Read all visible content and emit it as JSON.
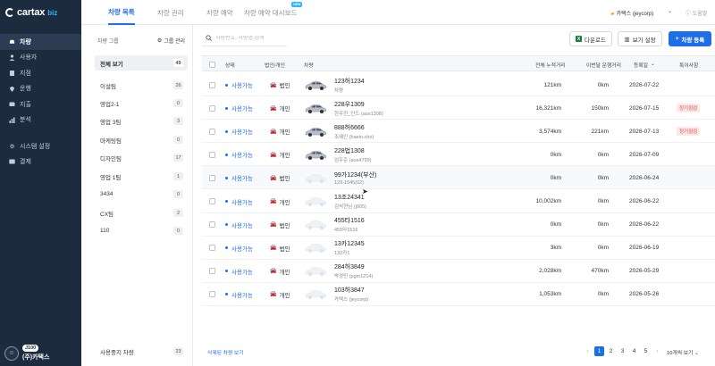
{
  "brand": {
    "name": "cartax",
    "suffix": "biz"
  },
  "sidebar": {
    "items": [
      {
        "label": "차량",
        "icon": "car-icon",
        "active": true
      },
      {
        "label": "사용자",
        "icon": "user-icon",
        "active": false
      },
      {
        "label": "지점",
        "icon": "branch-icon",
        "active": false
      },
      {
        "label": "운행",
        "icon": "location-icon",
        "active": false
      },
      {
        "label": "지출",
        "icon": "wallet-icon",
        "active": false
      },
      {
        "label": "분석",
        "icon": "chart-icon",
        "active": false
      }
    ],
    "bottom_items": [
      {
        "label": "시스템 설정",
        "icon": "gear-icon"
      },
      {
        "label": "결제",
        "icon": "card-icon"
      }
    ],
    "profile": {
      "badge": "J100",
      "name": "(주)카택스"
    }
  },
  "topbar": {
    "tabs": [
      {
        "label": "차량 목록",
        "active": true
      },
      {
        "label": "차량 관리",
        "active": false
      },
      {
        "label": "차량 예약",
        "active": false
      },
      {
        "label": "차량 예약 대시보드",
        "active": false,
        "badge": "NEW"
      }
    ],
    "account": "카택스 (jeycorp)",
    "help": "도움말"
  },
  "groups": {
    "title": "차량 그룹",
    "manage_label": "그룹 관리",
    "items": [
      {
        "label": "전체 보기",
        "count": "49",
        "active": true
      },
      {
        "label": "이설팀",
        "count": "26"
      },
      {
        "label": "영업2-1",
        "count": "0"
      },
      {
        "label": "영업 3팀",
        "count": "3"
      },
      {
        "label": "마케팅팀",
        "count": "0"
      },
      {
        "label": "디자인팀",
        "count": "17"
      },
      {
        "label": "영업 1팀",
        "count": "1"
      },
      {
        "label": "3434",
        "count": "0"
      },
      {
        "label": "CX팀",
        "count": "2"
      },
      {
        "label": "110",
        "count": "0"
      }
    ],
    "suspended": {
      "label": "사용중지 차량",
      "count": "23"
    }
  },
  "toolbar": {
    "search_placeholder": "차량번호, 차량명 검색",
    "download": "다운로드",
    "view_settings": "보기 설정",
    "add_vehicle": "차량 등록"
  },
  "table": {
    "headers": {
      "status": "상태",
      "ownership": "법인/개인",
      "vehicle": "차량",
      "total_distance": "전체 누적거리",
      "last_month": "이번달 운행거리",
      "registered": "등록일",
      "notes": "특이사항"
    },
    "rows": [
      {
        "status": "사용가능",
        "ownership": "법인",
        "plate": "123허1234",
        "owner": "차량",
        "car": "silver",
        "total": "121km",
        "month": "0km",
        "date": "2026-07-22",
        "note": ""
      },
      {
        "status": "사용가능",
        "ownership": "개인",
        "plate": "228우1309",
        "owner": "한우진_인드 (aos1308)",
        "car": "silver",
        "total": "16,321km",
        "month": "150km",
        "date": "2026-07-15",
        "note": "정기점검"
      },
      {
        "status": "사용가능",
        "ownership": "개인",
        "plate": "888허6666",
        "owner": "조혜인 (haein.cho)",
        "car": "silver",
        "total": "3,574km",
        "month": "221km",
        "date": "2026-07-13",
        "note": "정기점검"
      },
      {
        "status": "사용가능",
        "ownership": "개인",
        "plate": "228법1308",
        "owner": "임우준 (aos4799)",
        "car": "silver",
        "total": "0km",
        "month": "0km",
        "date": "2026-07-09",
        "note": ""
      },
      {
        "status": "사용가능",
        "ownership": "법인",
        "plate": "99가1234(부산)",
        "owner": "123-1545(02)",
        "car": "ghost",
        "total": "0km",
        "month": "0km",
        "date": "2026-06-24",
        "note": ""
      },
      {
        "status": "사용가능",
        "ownership": "개인",
        "plate": "13조24341",
        "owner": "김석현님 (j005)",
        "car": "ghost",
        "total": "10,002km",
        "month": "0km",
        "date": "2026-06-22",
        "note": ""
      },
      {
        "status": "사용가능",
        "ownership": "법인",
        "plate": "455타1516",
        "owner": "455타1516",
        "car": "ghost",
        "total": "0km",
        "month": "0km",
        "date": "2026-06-22",
        "note": ""
      },
      {
        "status": "사용가능",
        "ownership": "법인",
        "plate": "13카12345",
        "owner": "132카1",
        "car": "ghost",
        "total": "3km",
        "month": "0km",
        "date": "2026-06-19",
        "note": ""
      },
      {
        "status": "사용가능",
        "ownership": "개인",
        "plate": "284허3849",
        "owner": "박경민 (pgm1214)",
        "car": "ghost",
        "total": "2,028km",
        "month": "470km",
        "date": "2026-05-29",
        "note": ""
      },
      {
        "status": "사용가능",
        "ownership": "개인",
        "plate": "103허3847",
        "owner": "카택스 (jeycorp)",
        "car": "ghost",
        "total": "1,053km",
        "month": "0km",
        "date": "2026-05-26",
        "note": ""
      }
    ]
  },
  "footer": {
    "deleted_link": "삭제된 차량 보기",
    "pages": [
      "1",
      "2",
      "3",
      "4",
      "5"
    ],
    "current_page": "1",
    "per_page": "10개씩 보기"
  },
  "colors": {
    "accent": "#1e6ee8",
    "sidebar": "#1d2b3e",
    "badge_red": "#e04a4a",
    "corporate": "#2f6fd6",
    "personal": "#f08a1c"
  }
}
